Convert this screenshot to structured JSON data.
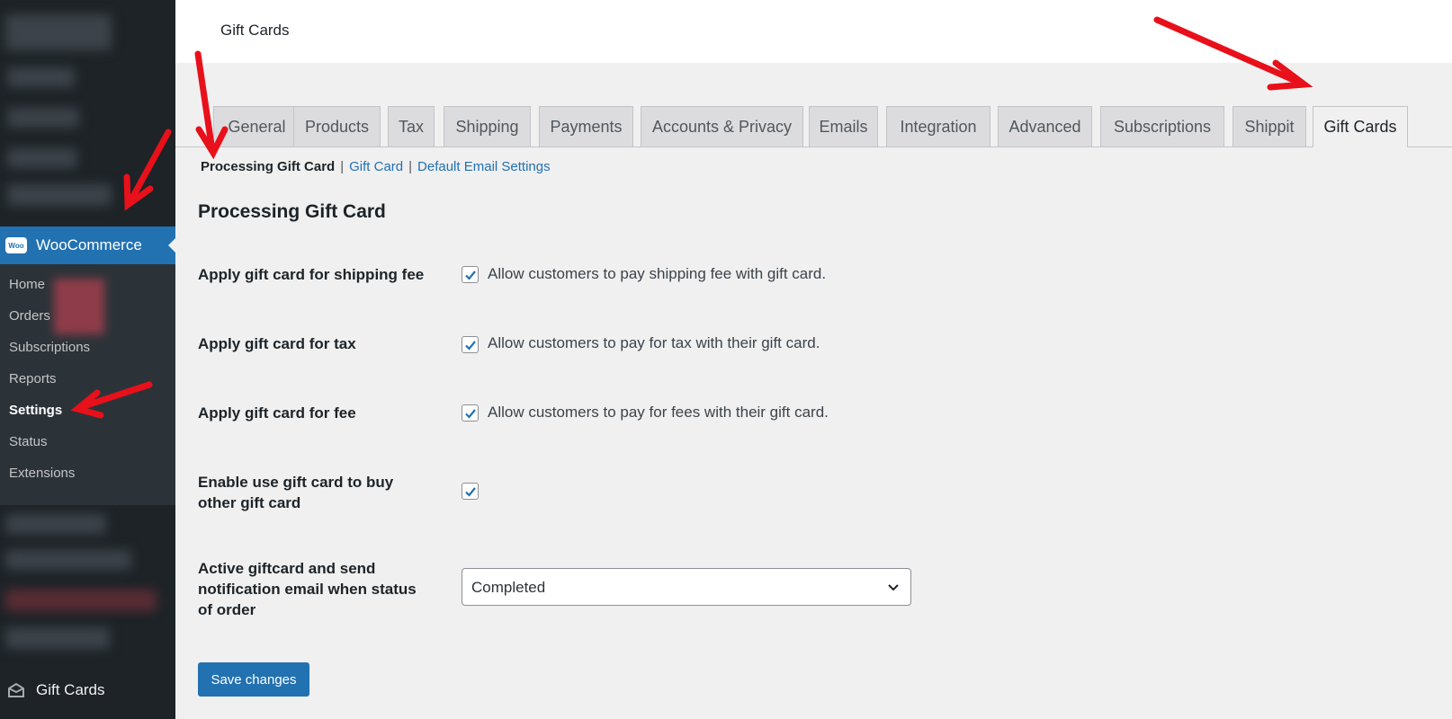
{
  "topbar": {
    "title": "Gift Cards"
  },
  "sidebar": {
    "woo_label": "WooCommerce",
    "woo_logo_text": "Woo",
    "submenu": [
      {
        "label": "Home"
      },
      {
        "label": "Orders"
      },
      {
        "label": "Subscriptions"
      },
      {
        "label": "Reports"
      },
      {
        "label": "Settings",
        "current": true
      },
      {
        "label": "Status"
      },
      {
        "label": "Extensions"
      }
    ],
    "gift_cards_label": "Gift Cards"
  },
  "tabs": [
    {
      "label": "General"
    },
    {
      "label": "Products"
    },
    {
      "label": "Tax"
    },
    {
      "label": "Shipping"
    },
    {
      "label": "Payments"
    },
    {
      "label": "Accounts & Privacy"
    },
    {
      "label": "Emails"
    },
    {
      "label": "Integration"
    },
    {
      "label": "Advanced"
    },
    {
      "label": "Subscriptions"
    },
    {
      "label": "Shippit"
    },
    {
      "label": "Gift Cards",
      "active": true
    }
  ],
  "subnav": {
    "current": "Processing Gift Card",
    "separator": "|",
    "links": [
      "Gift Card",
      "Default Email Settings"
    ]
  },
  "section_title": "Processing Gift Card",
  "settings": [
    {
      "label": "Apply gift card for shipping fee",
      "checked": true,
      "description": "Allow customers to pay shipping fee with gift card."
    },
    {
      "label": "Apply gift card for tax",
      "checked": true,
      "description": "Allow customers to pay for tax with their gift card."
    },
    {
      "label": "Apply gift card for fee",
      "checked": true,
      "description": "Allow customers to pay for fees with their gift card."
    },
    {
      "label": "Enable use gift card to buy other gift card",
      "checked": true,
      "description": ""
    },
    {
      "label": "Active giftcard and send notification email when status of order",
      "select_value": "Completed"
    }
  ],
  "save_button": "Save changes",
  "colors": {
    "accent": "#2271b1",
    "sidebar_bg": "#1d2327",
    "annotation_arrow": "#e8101a"
  }
}
